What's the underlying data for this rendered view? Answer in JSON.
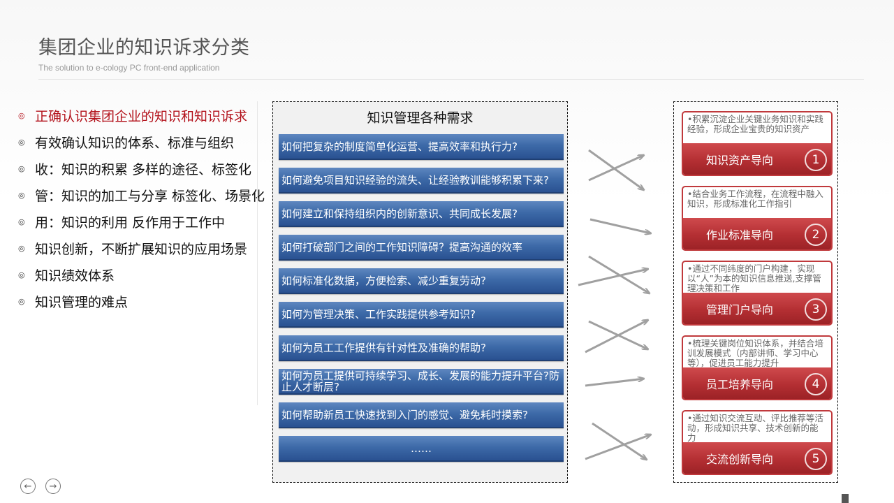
{
  "header": {
    "title": "集团企业的知识诉求分类",
    "subtitle": "The solution to e-cology PC front-end application"
  },
  "outline": {
    "items": [
      {
        "label": "正确认识集团企业的知识和知识诉求",
        "active": true
      },
      {
        "label": "有效确认知识的体系、标准与组织"
      },
      {
        "label": "收：知识的积累 多样的途径、标签化"
      },
      {
        "label": "管：知识的加工与分享 标签化、场景化"
      },
      {
        "label": "用：知识的利用 反作用于工作中"
      },
      {
        "label": "知识创新，不断扩展知识的应用场景"
      },
      {
        "label": "知识绩效体系"
      },
      {
        "label": "知识管理的难点"
      }
    ]
  },
  "needs": {
    "title": "知识管理各种需求",
    "items": [
      "如何把复杂的制度简单化运营、提高效率和执行力?",
      "如何避免项目知识经验的流失、让经验教训能够积累下来?",
      "如何建立和保持组织内的创新意识、共同成长发展?",
      "如何打破部门之间的工作知识障碍？提高沟通的效率",
      "如何标准化数据，方便检索、减少重复劳动?",
      "如何为管理决策、工作实践提供参考知识?",
      "如何为员工工作提供有针对性及准确的帮助?",
      "如何为员工提供可持续学习、成长、发展的能力提升平台?防止人才断层?",
      "如何帮助新员工快速找到入门的感觉、避免耗时摸索?",
      "……"
    ]
  },
  "orientations": {
    "items": [
      {
        "desc": "•积累沉淀企业关键业务知识和实践经验，形成企业宝贵的知识资产",
        "label": "知识资产导向",
        "num": "1"
      },
      {
        "desc": "•结合业务工作流程，在流程中融入知识，形成标准化工作指引",
        "label": "作业标准导向",
        "num": "2"
      },
      {
        "desc": "•通过不同纬度的门户构建，实现以“人”为本的知识信息推送,支撑管理决策和工作",
        "label": "管理门户导向",
        "num": "3"
      },
      {
        "desc": "•梳理关键岗位知识体系，并结合培训发展模式（内部讲师、学习中心等），促进员工能力提升",
        "label": "员工培养导向",
        "num": "4"
      },
      {
        "desc": "•通过知识交流互动、评比推荐等活动，形成知识共享、技术创新的能力",
        "label": "交流创新导向",
        "num": "5"
      }
    ]
  },
  "nav": {
    "prev_icon": "arrow-left-circle-icon",
    "next_icon": "arrow-right-circle-icon",
    "prev_glyph": "←",
    "next_glyph": "→"
  },
  "colors": {
    "accent_red": "#b42f33",
    "bar_blue": "#3d6aa8",
    "active_text": "#b3121b",
    "arrow_gray": "#a0a0a0"
  }
}
